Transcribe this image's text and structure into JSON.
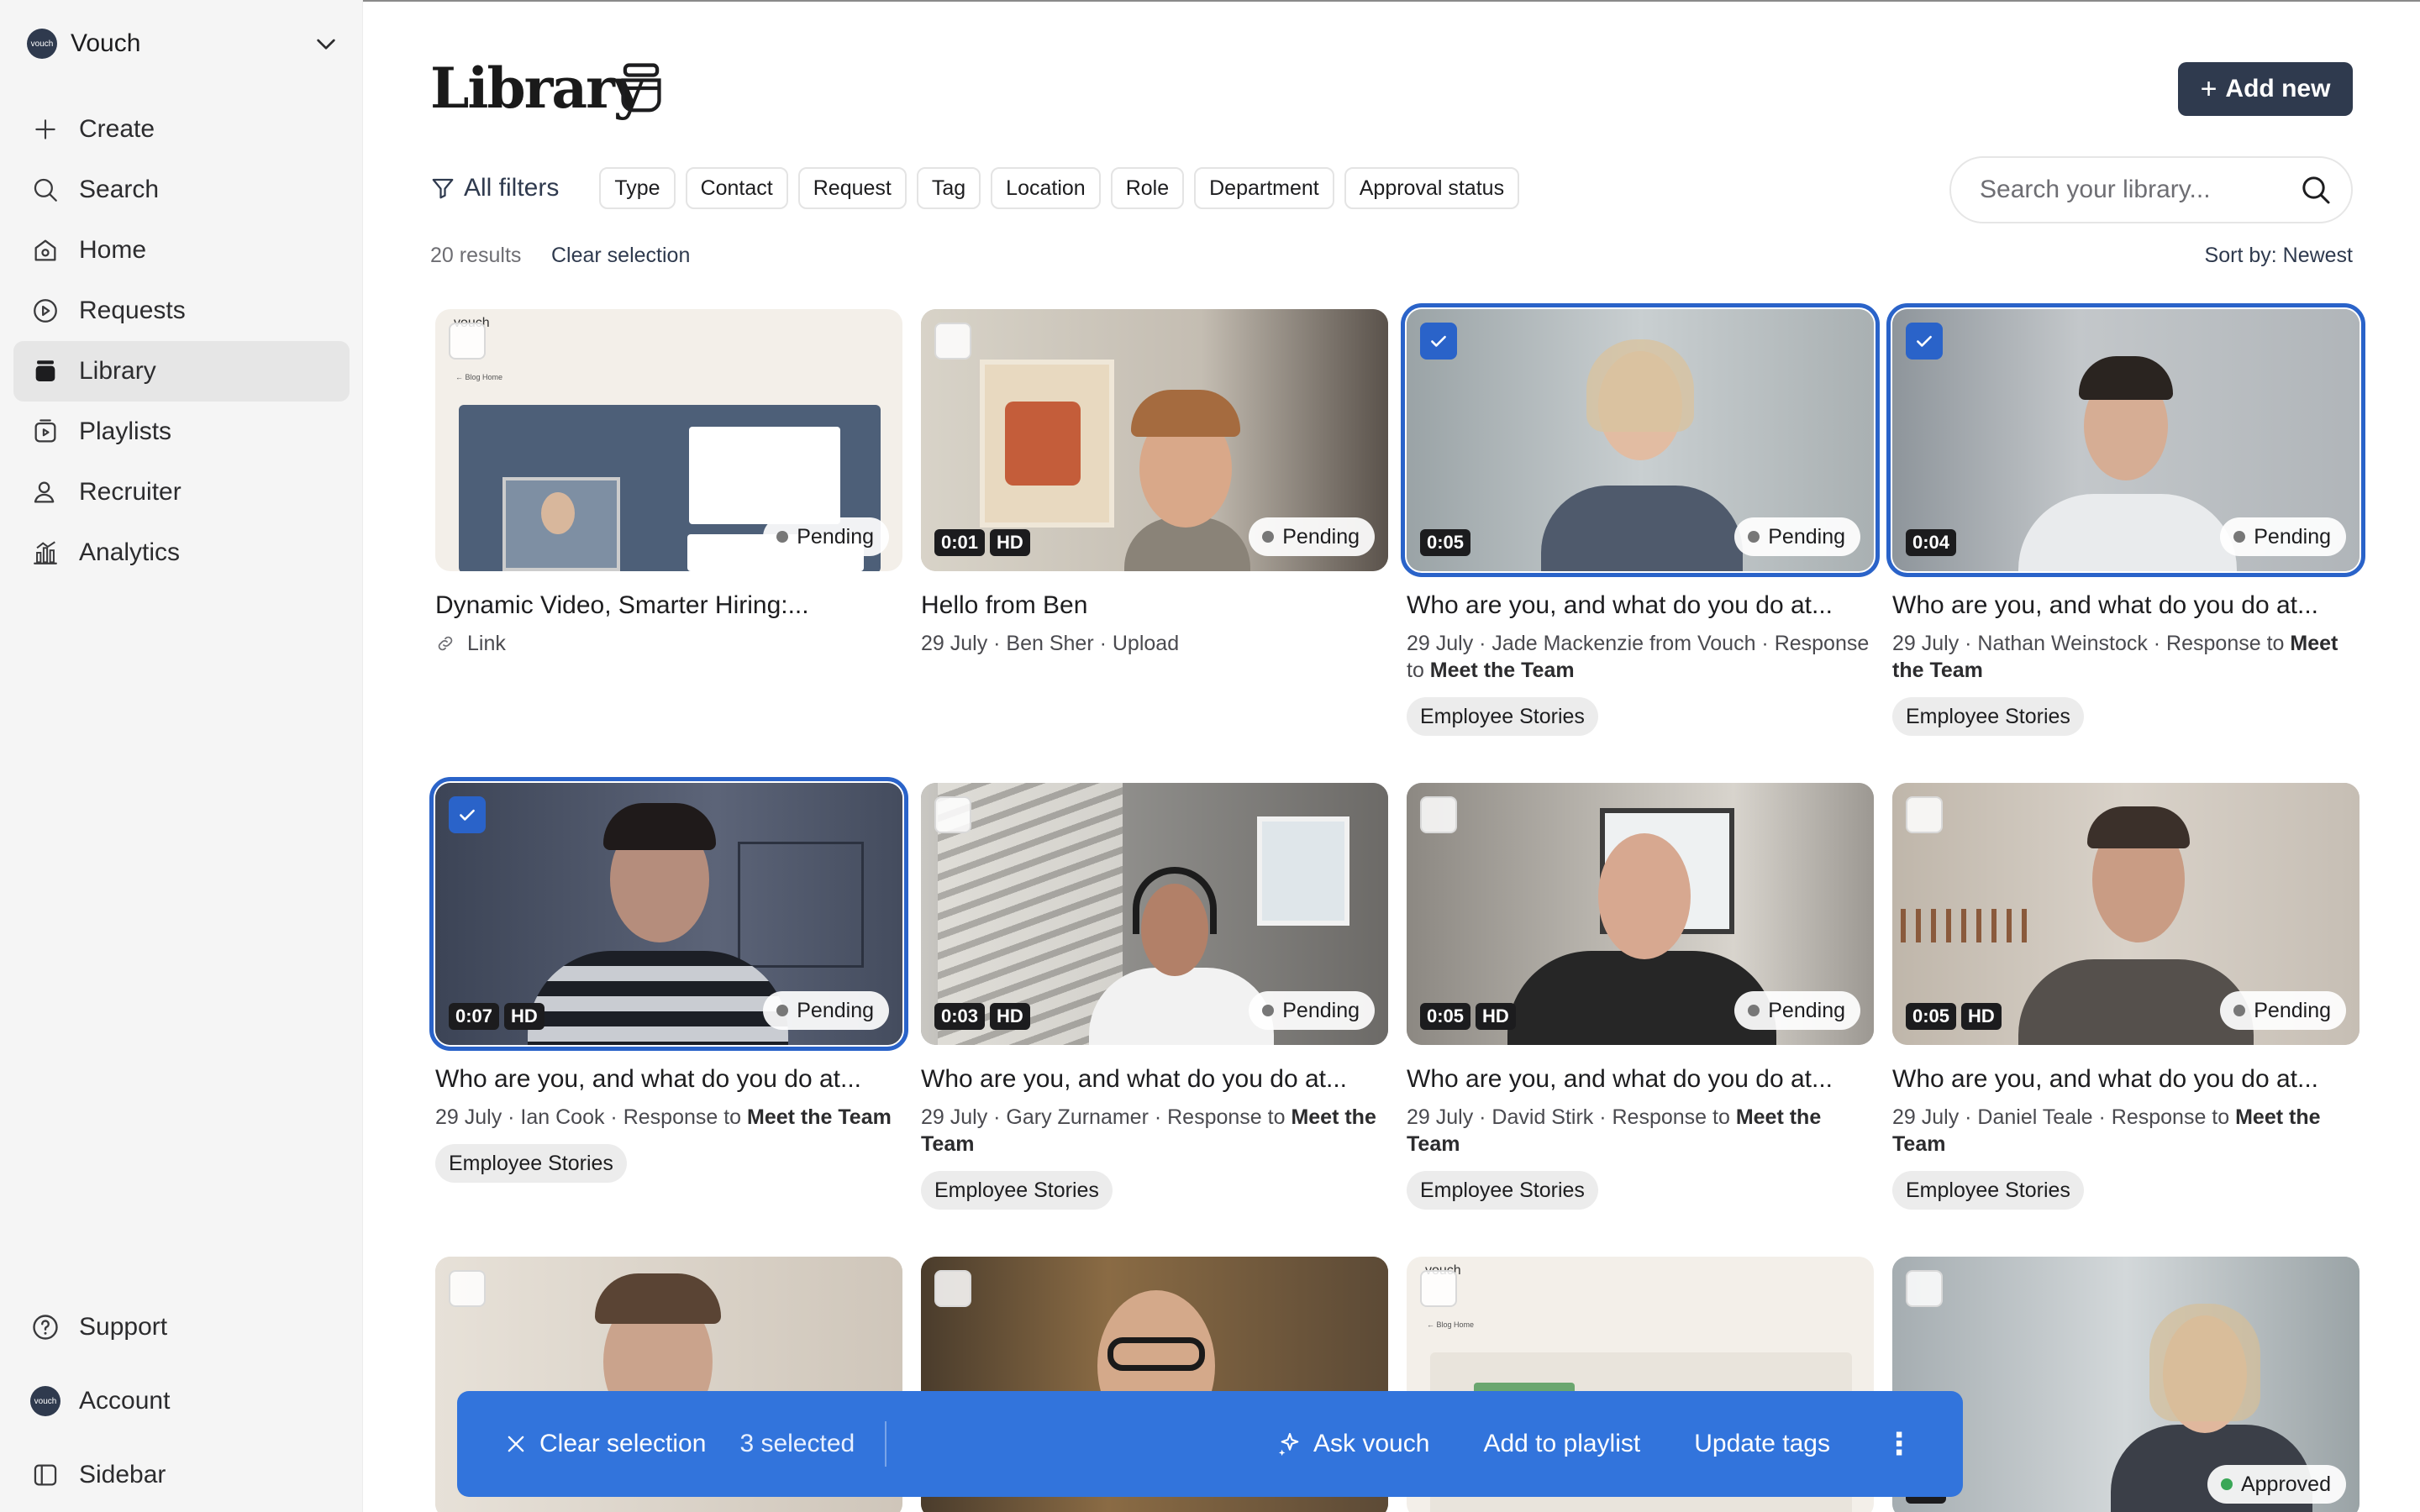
{
  "org": {
    "name": "Vouch",
    "logo_text": "vouch"
  },
  "nav": {
    "items": [
      {
        "label": "Create",
        "icon": "plus-icon"
      },
      {
        "label": "Search",
        "icon": "search-icon"
      },
      {
        "label": "Home",
        "icon": "home-icon"
      },
      {
        "label": "Requests",
        "icon": "requests-icon"
      },
      {
        "label": "Library",
        "icon": "library-icon",
        "active": true
      },
      {
        "label": "Playlists",
        "icon": "playlists-icon"
      },
      {
        "label": "Recruiter",
        "icon": "recruiter-icon"
      },
      {
        "label": "Analytics",
        "icon": "analytics-icon"
      }
    ],
    "bottom": [
      {
        "label": "Support",
        "icon": "help-icon"
      },
      {
        "label": "Account",
        "icon": "avatar-icon"
      },
      {
        "label": "Sidebar",
        "icon": "sidebar-icon"
      }
    ]
  },
  "header": {
    "title": "Library",
    "add_new": "Add new"
  },
  "filters": {
    "all": "All filters",
    "chips": [
      "Type",
      "Contact",
      "Request",
      "Tag",
      "Location",
      "Role",
      "Department",
      "Approval status"
    ],
    "search_placeholder": "Search your library..."
  },
  "results": {
    "count": "20 results",
    "clear": "Clear selection",
    "sort": "Sort by: Newest"
  },
  "cards": [
    {
      "title": "Dynamic Video, Smarter Hiring:...",
      "meta": "Link",
      "status": "Pending",
      "selected": false,
      "duration": "",
      "hd": false
    },
    {
      "title": "Hello from Ben",
      "meta": "29 July · Ben Sher · Upload",
      "status": "Pending",
      "selected": false,
      "duration": "0:01",
      "hd": true
    },
    {
      "title": "Who are you, and what do you do at...",
      "meta": "29 July · Jade Mackenzie from Vouch · Response to ",
      "meta_bold": "Meet the Team",
      "tag": "Employee Stories",
      "status": "Pending",
      "selected": true,
      "duration": "0:05",
      "hd": false
    },
    {
      "title": "Who are you, and what do you do at...",
      "meta": "29 July · Nathan Weinstock · Response to ",
      "meta_bold": "Meet the Team",
      "tag": "Employee Stories",
      "status": "Pending",
      "selected": true,
      "duration": "0:04",
      "hd": false
    },
    {
      "title": "Who are you, and what do you do at...",
      "meta": "29 July · Ian Cook · Response to ",
      "meta_bold": "Meet the Team",
      "tag": "Employee Stories",
      "status": "Pending",
      "selected": true,
      "duration": "0:07",
      "hd": true
    },
    {
      "title": "Who are you, and what do you do at...",
      "meta": "29 July · Gary Zurnamer · Response to ",
      "meta_bold": "Meet the Team",
      "tag": "Employee Stories",
      "status": "Pending",
      "selected": false,
      "duration": "0:03",
      "hd": true
    },
    {
      "title": "Who are you, and what do you do at...",
      "meta": "29 July · David Stirk · Response to ",
      "meta_bold": "Meet the Team",
      "tag": "Employee Stories",
      "status": "Pending",
      "selected": false,
      "duration": "0:05",
      "hd": true
    },
    {
      "title": "Who are you, and what do you do at...",
      "meta": "29 July · Daniel Teale · Response to ",
      "meta_bold": "Meet the Team",
      "tag": "Employee Stories",
      "status": "Pending",
      "selected": false,
      "duration": "0:05",
      "hd": true
    },
    {
      "status": "",
      "selected": false
    },
    {
      "status": "",
      "selected": false
    },
    {
      "status": "",
      "selected": false
    },
    {
      "status": "Approved",
      "selected": false,
      "hd": true
    }
  ],
  "selection_bar": {
    "clear": "Clear selection",
    "count": "3 selected",
    "ask": "Ask vouch",
    "playlist": "Add to playlist",
    "tags": "Update tags",
    "more": "⋮"
  },
  "colors": {
    "accent": "#2f3a4e",
    "selection": "#3274dc",
    "selected_outline": "#2a63c9"
  }
}
